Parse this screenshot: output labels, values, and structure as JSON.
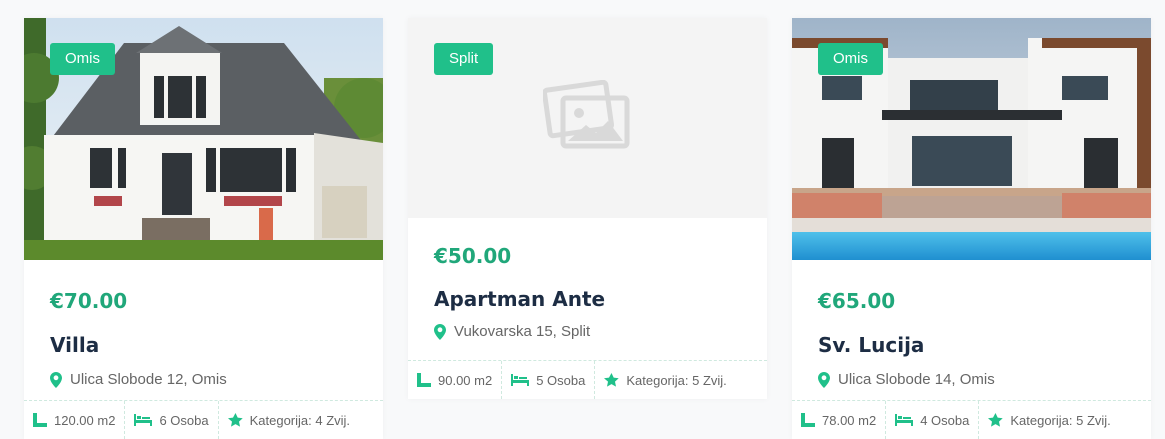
{
  "colors": {
    "accent": "#20c08a",
    "price": "#20a77a",
    "title": "#1d2d44"
  },
  "icons": {
    "location": "map-pin-icon",
    "area": "area-icon",
    "bed": "bed-icon",
    "star": "star-icon",
    "placeholder": "image-placeholder-icon"
  },
  "listings": [
    {
      "badge": "Omis",
      "price": "€70.00",
      "title": "Villa",
      "address": "Ulica Slobode 12, Omis",
      "area": "120.00 m2",
      "guests": "6 Osoba",
      "category": "Kategorija: 4 Zvij.",
      "image": "white-cottage-photo"
    },
    {
      "badge": "Split",
      "price": "€50.00",
      "title": "Apartman Ante",
      "address": "Vukovarska 15, Split",
      "area": "90.00 m2",
      "guests": "5 Osoba",
      "category": "Kategorija: 5 Zvij.",
      "image": "placeholder"
    },
    {
      "badge": "Omis",
      "price": "€65.00",
      "title": "Sv. Lucija",
      "address": "Ulica Slobode 14, Omis",
      "area": "78.00 m2",
      "guests": "4 Osoba",
      "category": "Kategorija: 5 Zvij.",
      "image": "modern-villa-pool-photo"
    }
  ]
}
